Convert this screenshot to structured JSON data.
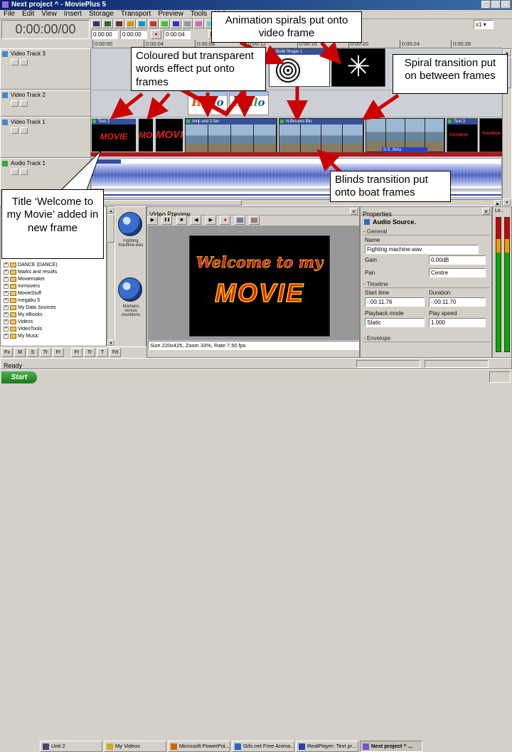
{
  "window": {
    "title": "Next project ^ - MoviePlus 5",
    "menus": [
      "File",
      "Edit",
      "View",
      "Insert",
      "Storage",
      "Transport",
      "Preview",
      "Tools",
      "Help"
    ]
  },
  "icons": {
    "minimize": "▁",
    "maximize": "▢",
    "close": "✕",
    "record": "●",
    "dropdown": "▾",
    "left": "◀",
    "right": "▶",
    "up": "▲",
    "down": "▼",
    "play": "▶",
    "pause": "❚❚",
    "stop": "■",
    "pinwheel": "✳"
  },
  "transport": {
    "big_timecode": "0:00:00/00",
    "fields": [
      "0:00:00",
      "0:00:00",
      "0:00:04"
    ],
    "zoom": "x1"
  },
  "ruler": {
    "ticks": [
      "0:00:00",
      "0:00:04",
      "0:00:08",
      "0:00:12",
      "0:00:16",
      "0:00:20",
      "0:00:24",
      "0:00:28"
    ]
  },
  "tracks": [
    "Video Track 3",
    "Video Track 2",
    "Video Track 1",
    "Audio Track 1"
  ],
  "clips": {
    "build_shape": "Build Shape 1",
    "hello": "Hello",
    "text2": "Text 2",
    "movie": "MOVIE",
    "boat1": "Amji and 2 fan",
    "boat2": "N.Browns Blu",
    "boat3": "S.S. Brita",
    "text3": "Text 3",
    "goodbye": "Goodbye"
  },
  "callouts": {
    "animation": "Animation spirals put onto video frame",
    "coloured": "Coloured but transparent words effect put onto frames",
    "spiral": "Spiral transition put on between frames",
    "blinds": "Blinds transition put onto boat frames",
    "title": "Title ‘Welcome to my Movie’ added in new frame"
  },
  "preview": {
    "title": "Video Preview",
    "line1": "Welcome to my",
    "line2": "MOVIE",
    "status": "Size 220x425, Zoom 33%, Rate 7.50 fps"
  },
  "properties": {
    "title": "Properties",
    "source": "Audio Source.",
    "general": "- General",
    "timeline": "- Timeline",
    "envelope": "- Envelope",
    "name_label": "Name",
    "name_value": "Fighting machine.wav",
    "gain_label": "Gain",
    "gain_value": "0.00dB",
    "pan_label": "Pan",
    "pan_value": "Centre",
    "start_label": "Start time",
    "start_value": "-:00:11.76",
    "duration_label": "Duration",
    "duration_value": "-:00:11.70",
    "mode_label": "Playback mode",
    "mode_value": "Static",
    "speed_label": "Play speed",
    "speed_value": "1.000"
  },
  "tree": {
    "items": [
      "DANCE (DANCE)",
      "Marks and results",
      "Moviemaker",
      "mrmovers",
      "MovieStuff",
      "megabu 5",
      "My Data Sources",
      "My eBooks",
      "Videos",
      "VideoTools",
      "My Music"
    ]
  },
  "filmstrip": {
    "captions": [
      "Fighting machine.wav",
      "Martians versus munitions"
    ]
  },
  "meters": {
    "label": "Le.."
  },
  "footer": {
    "buttons": [
      "Fx",
      "M",
      "S",
      "Tr",
      "Fr",
      "Fr",
      "Tr",
      "T",
      "Fd"
    ]
  },
  "statusbar": {
    "ready": "Ready"
  },
  "taskbar": {
    "start": "Start",
    "items": [
      "Unit 2",
      "My Videos",
      "Microsoft PowerPoi...",
      "Gifs.net Free Anima...",
      "RealPlayer: Text pr...",
      "Next project ^ ..."
    ]
  },
  "colors": {
    "arrow_red": "#cc0000",
    "movie_red": "#dd2200",
    "outline_yellow": "#ffcc00",
    "waveform_blue": "#2b46b4"
  }
}
